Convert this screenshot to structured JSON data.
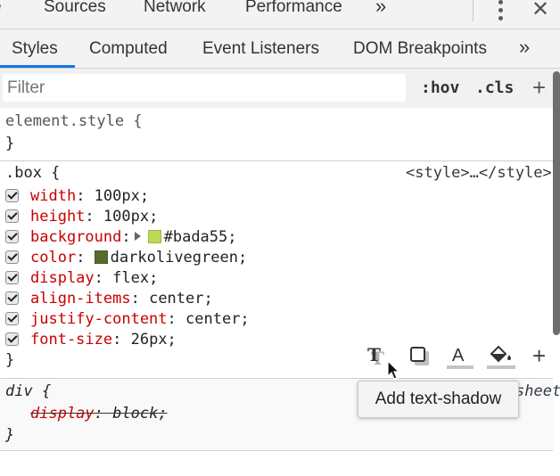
{
  "top_tabs": {
    "items": [
      {
        "label": "e"
      },
      {
        "label": "Sources"
      },
      {
        "label": "Network"
      },
      {
        "label": "Performance"
      }
    ],
    "overflow_icon": "chevron-double-right-icon",
    "overflow_label": "»",
    "menu_icon": "kebab-menu-icon",
    "close_icon": "close-icon",
    "close_label": "✕"
  },
  "sub_tabs": {
    "items": [
      {
        "label": "Styles",
        "active": true
      },
      {
        "label": "Computed"
      },
      {
        "label": "Event Listeners"
      },
      {
        "label": "DOM Breakpoints"
      }
    ],
    "overflow_label": "»",
    "accent_color": "#1a73e8"
  },
  "filter": {
    "placeholder": "Filter",
    "value": "",
    "hov_label": ":hov",
    "cls_label": ".cls",
    "new_rule_label": "+"
  },
  "rules": {
    "element_style": {
      "selector": "element.style {",
      "close": "}"
    },
    "box": {
      "selector": ".box {",
      "source": "<style>…</style>",
      "close": "}",
      "declarations": [
        {
          "prop": "width",
          "value": "100px;",
          "checked": true
        },
        {
          "prop": "height",
          "value": "100px;",
          "checked": true
        },
        {
          "prop": "background",
          "value": "#bada55;",
          "checked": true,
          "swatch": "#bada55",
          "expandable": true
        },
        {
          "prop": "color",
          "value": "darkolivegreen;",
          "checked": true,
          "swatch": "#556b2f"
        },
        {
          "prop": "display",
          "value": "flex;",
          "checked": true
        },
        {
          "prop": "align-items",
          "value": "center;",
          "checked": true
        },
        {
          "prop": "justify-content",
          "value": "center;",
          "checked": true
        },
        {
          "prop": "font-size",
          "value": "26px;",
          "checked": true
        }
      ]
    },
    "div": {
      "selector": "div {",
      "source_partial": "sheet",
      "close": "}",
      "declarations": [
        {
          "prop": "display",
          "value": "block;",
          "overridden": true
        }
      ]
    }
  },
  "style_toolbar": {
    "icons": [
      {
        "name": "text-shadow-icon"
      },
      {
        "name": "box-shadow-icon"
      },
      {
        "name": "text-color-icon"
      },
      {
        "name": "background-color-icon"
      },
      {
        "name": "add-property-icon",
        "label": "+"
      }
    ],
    "tooltip": "Add text-shadow"
  }
}
